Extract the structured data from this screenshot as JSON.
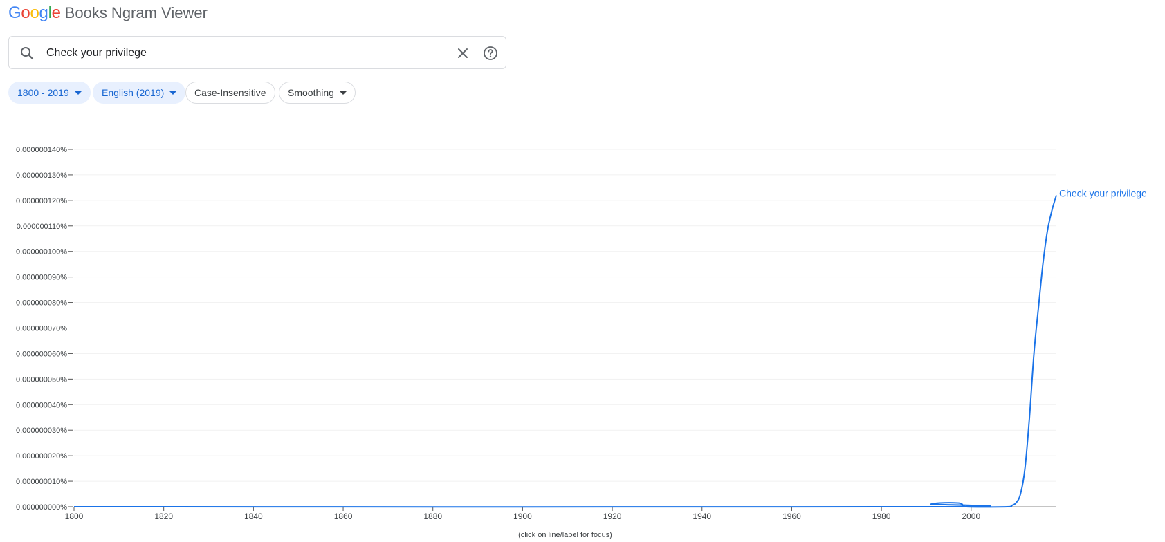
{
  "header": {
    "logo_letters": [
      {
        "ch": "G",
        "color": "#4285F4"
      },
      {
        "ch": "o",
        "color": "#EA4335"
      },
      {
        "ch": "o",
        "color": "#FBBC05"
      },
      {
        "ch": "g",
        "color": "#4285F4"
      },
      {
        "ch": "l",
        "color": "#34A853"
      },
      {
        "ch": "e",
        "color": "#EA4335"
      }
    ],
    "title": "Books Ngram Viewer"
  },
  "search": {
    "value": "Check your privilege",
    "icons": [
      "search-icon",
      "close-icon",
      "help-icon"
    ]
  },
  "filters": {
    "year_range": "1800 - 2019",
    "corpus": "English (2019)",
    "case": "Case-Insensitive",
    "smoothing": "Smoothing"
  },
  "chart_data": {
    "type": "line",
    "ylabel_format": "percent",
    "y_ticks": [
      "0.000000000%",
      "0.000000010%",
      "0.000000020%",
      "0.000000030%",
      "0.000000040%",
      "0.000000050%",
      "0.000000060%",
      "0.000000070%",
      "0.000000080%",
      "0.000000090%",
      "0.000000100%",
      "0.000000110%",
      "0.000000120%",
      "0.000000130%",
      "0.000000140%"
    ],
    "ylim": [
      0,
      1.4e-07
    ],
    "x_ticks": [
      "1800",
      "1820",
      "1840",
      "1860",
      "1880",
      "1900",
      "1920",
      "1940",
      "1960",
      "1980",
      "2000"
    ],
    "xlim": [
      1800,
      2019
    ],
    "grid": true,
    "series": [
      {
        "name": "Check your privilege",
        "color": "#1a73e8",
        "points": [
          [
            1800,
            0
          ],
          [
            1990,
            0
          ],
          [
            1991,
            1e-09
          ],
          [
            1993,
            1.5e-09
          ],
          [
            1997,
            1.5e-09
          ],
          [
            1998,
            1e-09
          ],
          [
            1999,
            0
          ],
          [
            2008,
            0
          ],
          [
            2009,
            5e-10
          ],
          [
            2010,
            1.5e-09
          ],
          [
            2011,
            5e-09
          ],
          [
            2012,
            1.5e-08
          ],
          [
            2013,
            3.5e-08
          ],
          [
            2014,
            6e-08
          ],
          [
            2015,
            7.8e-08
          ],
          [
            2016,
            9.5e-08
          ],
          [
            2017,
            1.08e-07
          ],
          [
            2018,
            1.16e-07
          ],
          [
            2019,
            1.22e-07
          ]
        ]
      }
    ],
    "note": "(click on line/label for focus)"
  }
}
